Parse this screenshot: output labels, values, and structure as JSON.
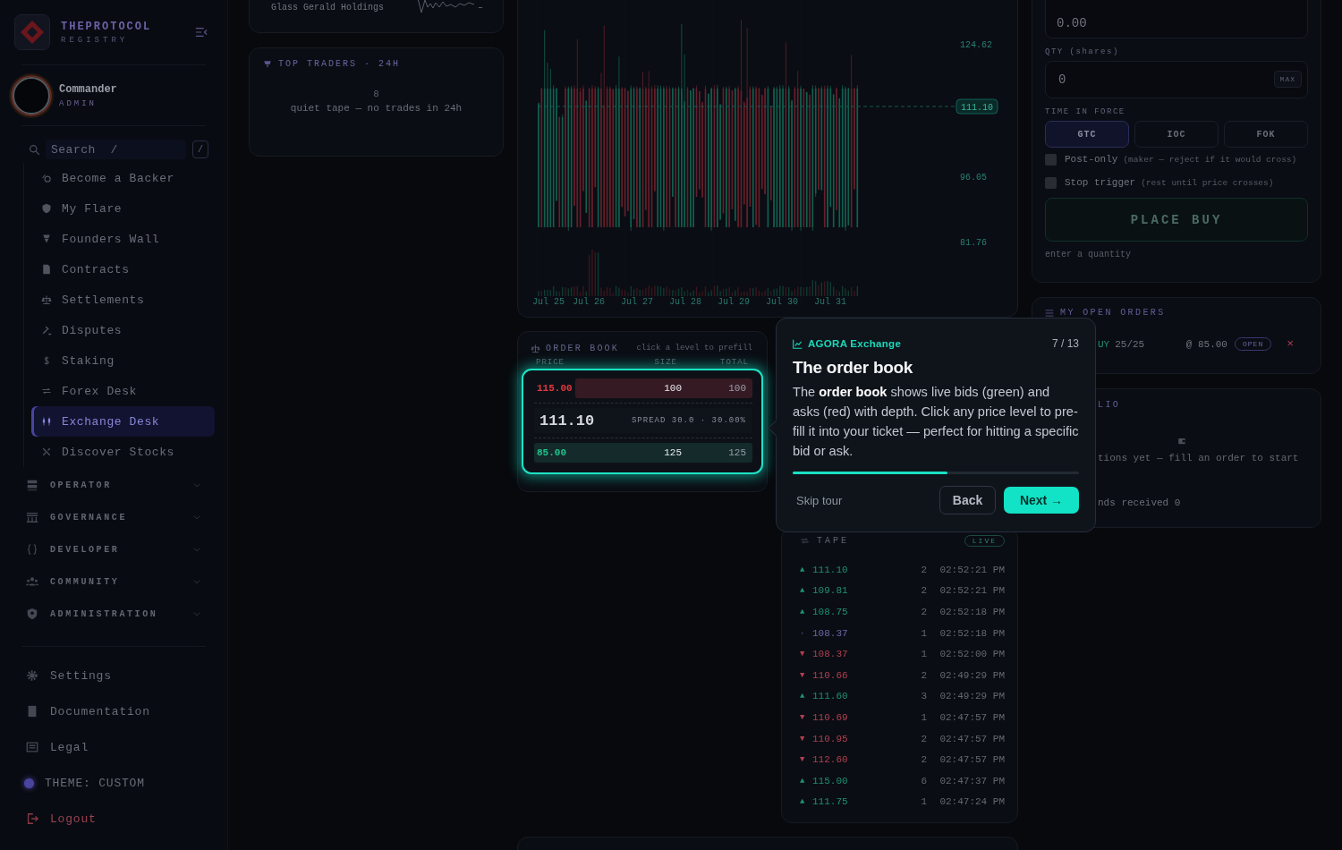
{
  "sidebar": {
    "brand": {
      "name": "THEPROTOCOL",
      "tagline": "REGISTRY"
    },
    "user": {
      "name": "Commander",
      "role": "ADMIN"
    },
    "search": {
      "placeholder": "Search  /",
      "shortcut": "/"
    },
    "nav": [
      {
        "label": "Become a Backer",
        "selected": false
      },
      {
        "label": "My Flare",
        "selected": false
      },
      {
        "label": "Founders Wall",
        "selected": false
      },
      {
        "label": "Contracts",
        "selected": false
      },
      {
        "label": "Settlements",
        "selected": false
      },
      {
        "label": "Disputes",
        "selected": false
      },
      {
        "label": "Staking",
        "selected": false
      },
      {
        "label": "Forex Desk",
        "selected": false
      },
      {
        "label": "Exchange Desk",
        "selected": true
      },
      {
        "label": "Discover Stocks",
        "selected": false
      }
    ],
    "groups": [
      {
        "label": "OPERATOR",
        "expanded": false
      },
      {
        "label": "GOVERNANCE",
        "expanded": false
      },
      {
        "label": "DEVELOPER",
        "expanded": false
      },
      {
        "label": "COMMUNITY",
        "expanded": false
      },
      {
        "label": "ADMINISTRATION",
        "expanded": false
      }
    ],
    "footer": [
      {
        "label": "Settings",
        "kind": "link"
      },
      {
        "label": "Documentation",
        "kind": "link"
      },
      {
        "label": "Legal",
        "kind": "link"
      },
      {
        "label": "THEME: CUSTOM",
        "kind": "theme"
      },
      {
        "label": "Logout",
        "kind": "logout"
      }
    ]
  },
  "holding": {
    "name": "Glass Gerald Holdings",
    "change": "–"
  },
  "top_traders": {
    "title": "TOP TRADERS · 24H",
    "count": "8",
    "empty": "quiet tape — no trades in 24h"
  },
  "chart": {
    "y_labels": [
      "124.62",
      "96.05",
      "81.76"
    ],
    "last_price": "111.10",
    "x_labels": [
      "Jul 25",
      "Jul 26",
      "Jul 27",
      "Jul 28",
      "Jul 29",
      "Jul 30",
      "Jul 31"
    ]
  },
  "order_book": {
    "title": "ORDER BOOK",
    "hint": "click a level to prefill",
    "columns": [
      "PRICE",
      "SIZE",
      "TOTAL"
    ],
    "ask": {
      "price": "115.00",
      "size": "100",
      "total": "100",
      "level": 0.81
    },
    "last": "111.10",
    "spread": "SPREAD 30.0 · 30.00%",
    "bid": {
      "price": "85.00",
      "size": "125",
      "total": "125",
      "level": 1
    }
  },
  "tape": {
    "title": "TAPE",
    "badge": "LIVE",
    "trades": [
      {
        "kind": "up",
        "arrow": "▲",
        "price": "111.10",
        "qty": "2",
        "time": "02:52:21 PM"
      },
      {
        "kind": "up",
        "arrow": "▲",
        "price": "109.81",
        "qty": "2",
        "time": "02:52:21 PM"
      },
      {
        "kind": "up",
        "arrow": "▲",
        "price": "108.75",
        "qty": "2",
        "time": "02:52:18 PM"
      },
      {
        "kind": "flat",
        "arrow": "·",
        "price": "108.37",
        "qty": "1",
        "time": "02:52:18 PM"
      },
      {
        "kind": "down",
        "arrow": "▼",
        "price": "108.37",
        "qty": "1",
        "time": "02:52:00 PM"
      },
      {
        "kind": "down",
        "arrow": "▼",
        "price": "110.66",
        "qty": "2",
        "time": "02:49:29 PM"
      },
      {
        "kind": "up",
        "arrow": "▲",
        "price": "111.60",
        "qty": "3",
        "time": "02:49:29 PM"
      },
      {
        "kind": "down",
        "arrow": "▼",
        "price": "110.69",
        "qty": "1",
        "time": "02:47:57 PM"
      },
      {
        "kind": "down",
        "arrow": "▼",
        "price": "110.95",
        "qty": "2",
        "time": "02:47:57 PM"
      },
      {
        "kind": "down",
        "arrow": "▼",
        "price": "112.60",
        "qty": "2",
        "time": "02:47:57 PM"
      },
      {
        "kind": "up",
        "arrow": "▲",
        "price": "115.00",
        "qty": "6",
        "time": "02:47:37 PM"
      },
      {
        "kind": "up",
        "arrow": "▲",
        "price": "111.75",
        "qty": "1",
        "time": "02:47:24 PM"
      }
    ]
  },
  "order_form": {
    "price": "0.00",
    "qty_label": "QTY (shares)",
    "qty": "0",
    "max": "MAX",
    "tif_label": "TIME IN FORCE",
    "tif": [
      {
        "label": "GTC",
        "selected": true
      },
      {
        "label": "IOC",
        "selected": false
      },
      {
        "label": "FOK",
        "selected": false
      }
    ],
    "options": [
      {
        "label": "Post-only",
        "hint": "(maker — reject if it would cross)",
        "checked": false
      },
      {
        "label": "Stop trigger",
        "hint": "(rest until price crosses)",
        "checked": false
      }
    ],
    "submit": {
      "label": "PLACE BUY",
      "disabled": true
    },
    "note": "enter a quantity"
  },
  "open_orders": {
    "title": "MY OPEN ORDERS",
    "orders": [
      {
        "side": "UY",
        "filled": "25/25",
        "price": "@ 85.00",
        "status": "OPEN",
        "cancel": "×"
      }
    ]
  },
  "portfolio": {
    "title": "LIO",
    "empty": "tions yet — fill an order to start",
    "dividends": "nds received 0"
  },
  "tour": {
    "brand": "AGORA Exchange",
    "step": "7 / 13",
    "title": "The order book",
    "body": "The **order book** shows live bids (green) and asks (red) with depth. Click any price level to pre-fill it into your ticket — perfect for hitting a specific bid or ask.",
    "level": 0.54,
    "skip": "Skip tour",
    "back": "Back",
    "next": "Next →"
  }
}
